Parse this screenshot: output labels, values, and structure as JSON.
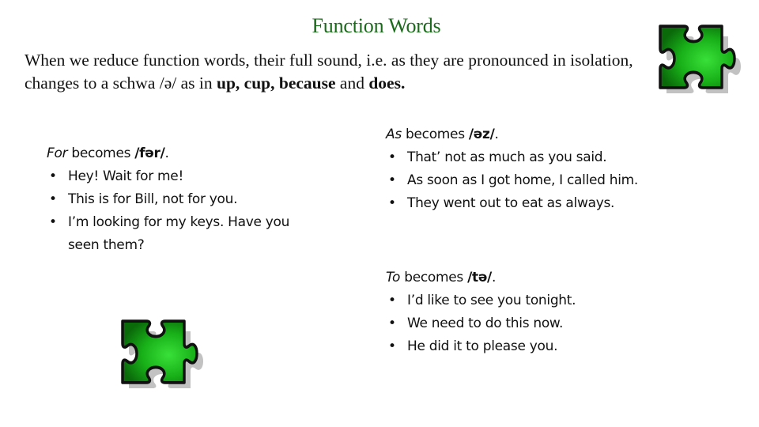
{
  "slide": {
    "title": "Function Words",
    "intro": {
      "text_before": "When we reduce function words, their full sound, i.e. as they are pronounced in isolation, changes to a schwa /ə/ as in ",
      "bold_1": "up, cup, because",
      "text_middle": " and ",
      "bold_2": "does."
    },
    "sections": [
      {
        "word": "For",
        "becomes": " becomes ",
        "ipa": "/fər/",
        "period": ".",
        "examples": [
          "Hey!  Wait for me!",
          "This is for Bill, not for you.",
          "I’m looking for my keys. Have you seen them?"
        ]
      },
      {
        "word": "As",
        "becomes": " becomes ",
        "ipa": "/əz/",
        "period": ".",
        "examples": [
          "That’ not as much as you said.",
          "As soon as I got home, I called him.",
          "They went out to eat as always."
        ]
      },
      {
        "word": "To",
        "becomes": " becomes ",
        "ipa": "/tə/",
        "period": ".",
        "examples": [
          "I’d like to see you tonight.",
          "We need to do this now.",
          "He did it to please you."
        ]
      }
    ],
    "bullet_glyph": "•",
    "decorations": {
      "icon": "puzzle-piece-icon",
      "fill_color": "#22c322",
      "dark_color": "#0a6a0a",
      "outline_color": "#111111"
    }
  }
}
